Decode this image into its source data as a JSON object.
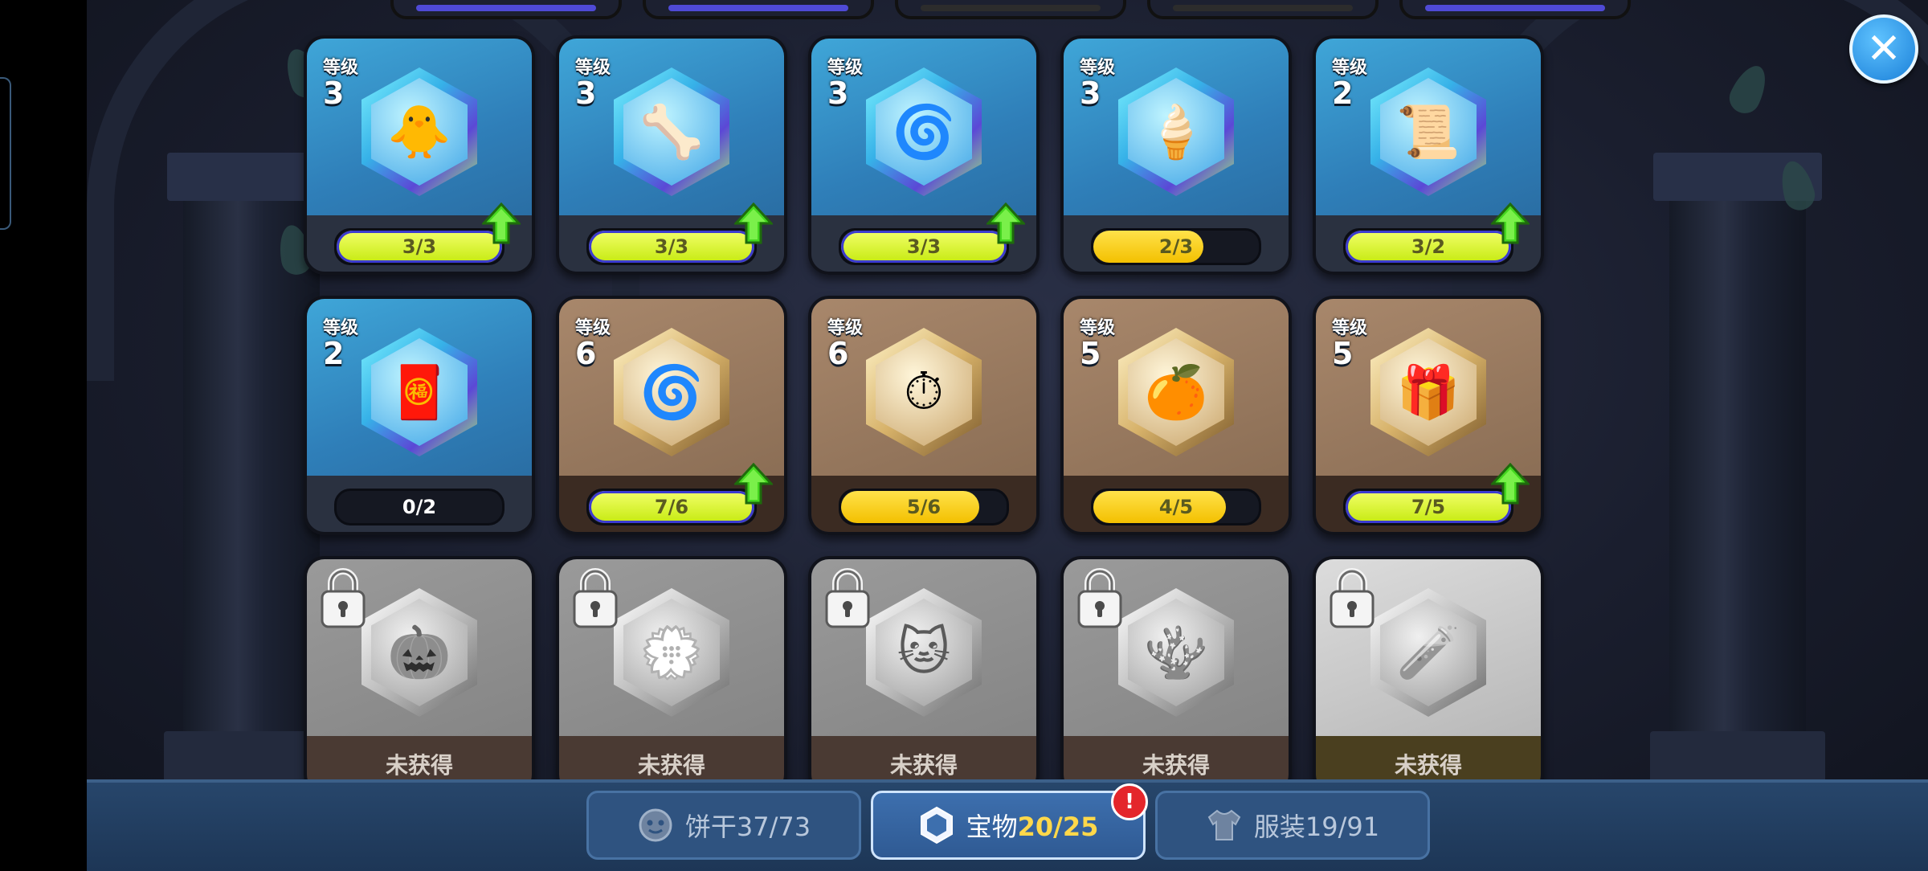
{
  "top_row_visible": 5,
  "close_label": "✕",
  "level_label": "等级",
  "locked_text": "未获得",
  "cards": [
    {
      "level": "3",
      "progress": "3/3",
      "fill": 1.0,
      "style": "blue",
      "icon": "pink-bird-treasure-icon",
      "glyph": "🐥",
      "upgradable": true
    },
    {
      "level": "3",
      "progress": "3/3",
      "fill": 1.0,
      "style": "blue",
      "icon": "bone-scythe-treasure-icon",
      "glyph": "🦴",
      "upgradable": true
    },
    {
      "level": "3",
      "progress": "3/3",
      "fill": 1.0,
      "style": "blue",
      "icon": "swirl-cloud-treasure-icon",
      "glyph": "🌀",
      "upgradable": true
    },
    {
      "level": "3",
      "progress": "2/3",
      "fill": 0.667,
      "style": "blue",
      "icon": "ice-cream-necklace-treasure-icon",
      "glyph": "🍦",
      "upgradable": false
    },
    {
      "level": "2",
      "progress": "3/2",
      "fill": 1.0,
      "style": "blue",
      "icon": "ghost-scroll-treasure-icon",
      "glyph": "📜",
      "upgradable": true
    },
    {
      "level": "2",
      "progress": "0/2",
      "fill": 0.0,
      "style": "blue",
      "icon": "red-talisman-treasure-icon",
      "glyph": "🧧",
      "upgradable": false
    },
    {
      "level": "6",
      "progress": "7/6",
      "fill": 1.0,
      "style": "brown",
      "icon": "purple-swirl-treasure-icon",
      "glyph": "🌀",
      "upgradable": true
    },
    {
      "level": "6",
      "progress": "5/6",
      "fill": 0.833,
      "style": "brown",
      "icon": "stopwatch-treasure-icon",
      "glyph": "⏱",
      "upgradable": false
    },
    {
      "level": "5",
      "progress": "4/5",
      "fill": 0.8,
      "style": "brown",
      "icon": "orange-jelly-treasure-icon",
      "glyph": "🍊",
      "upgradable": false
    },
    {
      "level": "5",
      "progress": "7/5",
      "fill": 1.0,
      "style": "brown",
      "icon": "treasure-chest-treasure-icon",
      "glyph": "🎁",
      "upgradable": true
    }
  ],
  "locked_cards": [
    {
      "icon": "pumpkin-treasure-icon",
      "glyph": "🎃",
      "light": false
    },
    {
      "icon": "flower-wreath-treasure-icon",
      "glyph": "💮",
      "light": false
    },
    {
      "icon": "cat-treasure-icon",
      "glyph": "🐱",
      "light": false
    },
    {
      "icon": "coral-treasure-icon",
      "glyph": "🪸",
      "light": false
    },
    {
      "icon": "potion-bottle-treasure-icon",
      "glyph": "🧪",
      "light": true
    }
  ],
  "tabs": {
    "cookies": {
      "label": "饼干",
      "count": "37/73"
    },
    "treasures": {
      "label": "宝物",
      "count": "20/25",
      "badge": "!"
    },
    "costumes": {
      "label": "服装",
      "count": "19/91"
    }
  }
}
